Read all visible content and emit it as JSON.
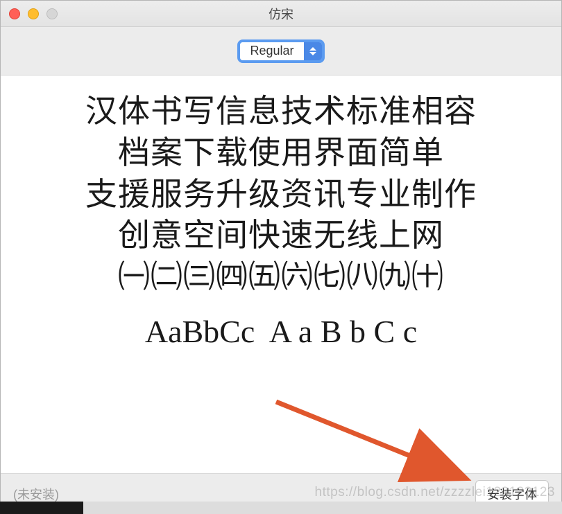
{
  "window": {
    "title": "仿宋"
  },
  "toolbar": {
    "style_selected": "Regular"
  },
  "preview": {
    "line1": "汉体书写信息技术标准相容",
    "line2": "档案下载使用界面简单",
    "line3": "支援服务升级资讯专业制作",
    "line4": "创意空间快速无线上网",
    "line5": "㈠㈡㈢㈣㈤㈥㈦㈧㈨㈩",
    "latin": "AaBbCc  A a B b C c"
  },
  "footer": {
    "status": "(未安装)",
    "install_label": "安装字体"
  },
  "watermark": "https://blog.csdn.net/zzzzlei123123123"
}
